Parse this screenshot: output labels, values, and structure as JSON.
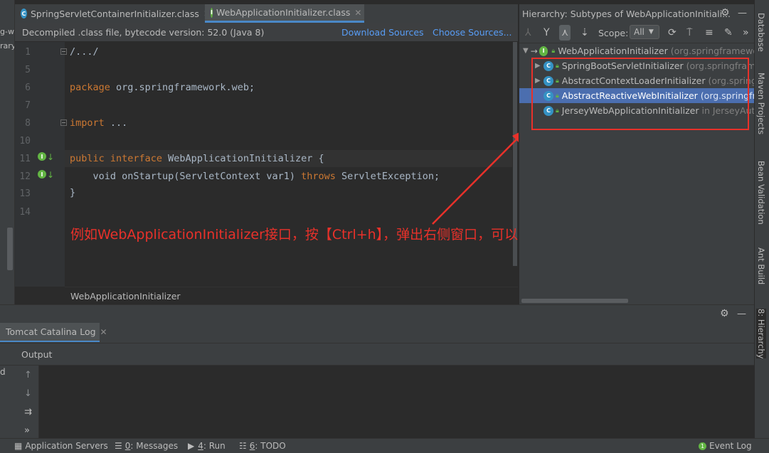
{
  "left_panel": {
    "fragments": [
      "g-w",
      "rary"
    ]
  },
  "tabs": [
    {
      "label": "SpringServletContainerInitializer.class",
      "icon": "class-icon",
      "active": false
    },
    {
      "label": "WebApplicationInitializer.class",
      "icon": "interface-icon",
      "active": true
    }
  ],
  "banner": {
    "text": "Decompiled .class file, bytecode version: 52.0 (Java 8)",
    "download_sources": "Download Sources",
    "choose_sources": "Choose Sources..."
  },
  "editor": {
    "lines": [
      {
        "num": "1",
        "code": "/.../"
      },
      {
        "num": "5",
        "code": ""
      },
      {
        "num": "6",
        "kw": "package",
        "rest": " org.springframework.web;"
      },
      {
        "num": "7",
        "code": ""
      },
      {
        "num": "8",
        "kw": "import",
        "rest": " ..."
      },
      {
        "num": "10",
        "code": ""
      },
      {
        "num": "11",
        "kw": "public interface",
        "rest": " WebApplicationInitializer {"
      },
      {
        "num": "12",
        "pre": "    void onStartup(ServletContext var1) ",
        "kw": "throws",
        "rest": " ServletException;"
      },
      {
        "num": "13",
        "code": "}"
      },
      {
        "num": "14",
        "code": ""
      }
    ],
    "breadcrumb": "WebApplicationInitializer"
  },
  "annotation": {
    "text": "例如WebApplicationInitializer接口，按【Ctrl+h】，弹出右侧窗口，可以看到画红框的四个实现类",
    "color": "#e8312a"
  },
  "hierarchy": {
    "title": "Hierarchy:",
    "subtitle": "Subtypes of WebApplicationInitiali...",
    "scope_label": "Scope:",
    "scope_value": "All",
    "root": {
      "name": "WebApplicationInitializer",
      "pkg": "(org.springframewo"
    },
    "children": [
      {
        "name": "SpringBootServletInitializer",
        "pkg": "(org.springframe",
        "expandable": true,
        "selected": false
      },
      {
        "name": "AbstractContextLoaderInitializer",
        "pkg": "(org.spring",
        "expandable": true,
        "selected": false
      },
      {
        "name": "AbstractReactiveWebInitializer",
        "pkg": "(org.springfr",
        "expandable": false,
        "selected": true
      },
      {
        "name": "JerseyWebApplicationInitializer",
        "pkg": "in JerseyAuto",
        "expandable": false,
        "selected": false
      }
    ]
  },
  "right_stripe": [
    "Database",
    "Maven Projects",
    "Bean Validation",
    "Ant Build",
    "8: Hierarchy"
  ],
  "run": {
    "tab_label": "Tomcat Catalina Log",
    "output_label": "Output",
    "side_fragment": "d"
  },
  "statusbar": {
    "app_servers": "Application Servers",
    "messages_num": "0",
    "messages": ": Messages",
    "run_num": "4",
    "run": ": Run",
    "todo_num": "6",
    "todo": ": TODO",
    "event_log": "Event Log"
  },
  "colors": {
    "accent": "#4a88c7",
    "selection": "#4b6eaf",
    "keyword": "#cc7832",
    "red": "#e8312a",
    "green": "#62b543"
  }
}
